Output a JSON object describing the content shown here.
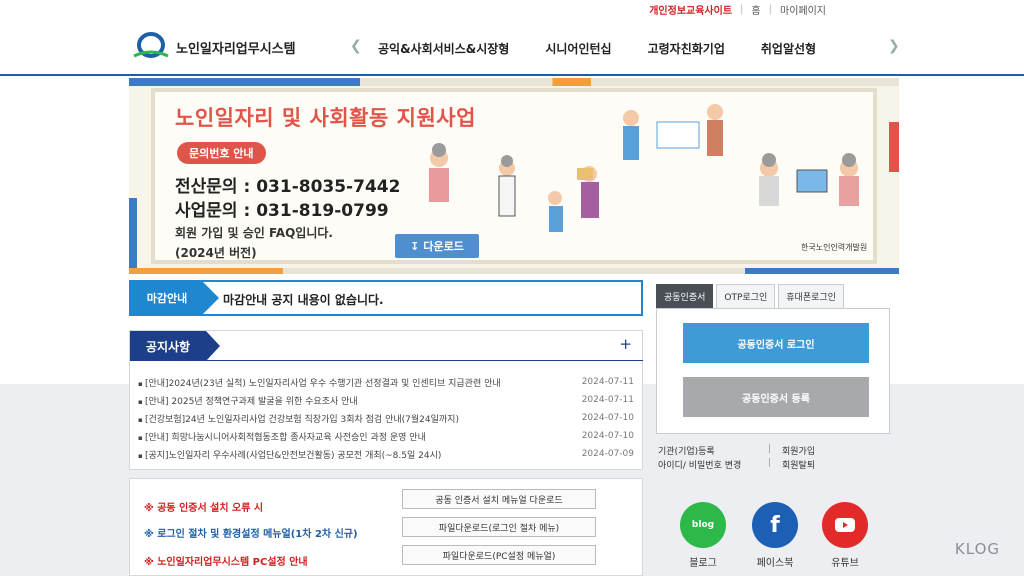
{
  "util": {
    "privacy": "개인정보교육사이트",
    "home": "홈",
    "mypage": "마이페이지"
  },
  "header": {
    "logo_text": "노인일자리업무시스템",
    "menu": [
      "공익&사회서비스&시장형",
      "시니어인턴십",
      "고령자친화기업",
      "취업알선형"
    ]
  },
  "banner": {
    "title": "노인일자리 및 사회활동 지원사업",
    "pill": "문의번호 안내",
    "line1_label": "전산문의 : ",
    "line1_num": "031-8035-7442",
    "line2_label": "사업문의 : ",
    "line2_num": "031-819-0799",
    "faq": "회원 가입 및 승인 FAQ입니다.",
    "version": "(2024년 버전)",
    "download": "다운로드",
    "org": "한국노인인력개발원"
  },
  "deadline": {
    "tag": "마감안내",
    "message": "마감안내 공지 내용이 없습니다."
  },
  "notice": {
    "title": "공지사항",
    "more": "+",
    "items": [
      {
        "title": "[안내]2024년(23년 실적) 노인일자리사업 우수 수행기관 선정결과 및 인센티브 지급관련 안내",
        "date": "2024-07-11"
      },
      {
        "title": "[안내] 2025년 정책연구과제 발굴을 위한 수요조사 안내",
        "date": "2024-07-11"
      },
      {
        "title": "[건강보험]24년 노인일자리사업 건강보험 직장가입 3회차 점검 안내(7월24일까지)",
        "date": "2024-07-10"
      },
      {
        "title": "[안내] 희망나눔시니어사회적협동조합 종사자교육 사전승인 과정 운영 안내",
        "date": "2024-07-10"
      },
      {
        "title": "[공지]노인일자리 우수사례(사업단&안전보건활동) 공모전 개최(~8.5일 24시)",
        "date": "2024-07-09"
      }
    ]
  },
  "install": {
    "r1": "※ 공동 인증서 설치 오류 시",
    "r2": "※ 로그인 절차 및 환경설정 메뉴얼(1차 2차 신규)",
    "r3": "※ 노인일자리업무시스템 PC설정 안내",
    "b1": "공동 인증서 설치 메뉴얼 다운로드",
    "b2": "파일다운로드(로그인 절차 메뉴)",
    "b3": "파일다운로드(PC설정 메뉴얼)"
  },
  "login": {
    "tabs": [
      "공동인증서",
      "OTP로그인",
      "휴대폰로그인"
    ],
    "cert_login": "공동인증서 로그인",
    "cert_register": "공동인증서 등록",
    "link_org": "기관(기업)등록",
    "link_join": "회원가입",
    "link_find": "아이디/ 비밀번호 변경",
    "link_withdraw": "회원탈퇴",
    "bar": "|"
  },
  "sns": {
    "blog": "블로그",
    "blog_icon_text": "blog",
    "facebook": "페이스북",
    "youtube": "유튜브"
  },
  "watermark": "KLOG"
}
